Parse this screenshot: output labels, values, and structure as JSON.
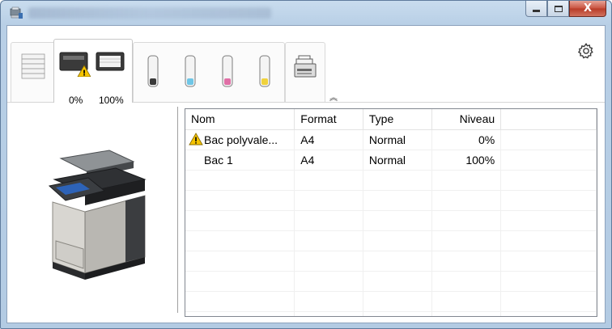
{
  "window": {
    "title": "",
    "controls": {
      "minimize": "–",
      "maximize": "□",
      "close": "X"
    }
  },
  "tabs": [
    {
      "name": "pages",
      "icon": "pages-stack-icon"
    },
    {
      "name": "trays",
      "icon": "paper-tray-icon",
      "values": [
        "0%",
        "100%"
      ],
      "active": true
    },
    {
      "name": "toner",
      "icon": "toner-cartridge-icon",
      "cartridges": [
        "black",
        "cyan",
        "magenta",
        "yellow"
      ]
    },
    {
      "name": "device",
      "icon": "scanner-device-icon"
    }
  ],
  "tray_levels": {
    "multipurpose": 0,
    "tray1": 1.0
  },
  "table": {
    "columns": [
      "Nom",
      "Format",
      "Type",
      "Niveau"
    ],
    "rows": [
      {
        "name": "Bac polyvale...",
        "format": "A4",
        "type": "Normal",
        "level": "0%",
        "warning": true
      },
      {
        "name": "Bac 1",
        "format": "A4",
        "type": "Normal",
        "level": "100%",
        "warning": false
      }
    ]
  },
  "colors": {
    "cyan": "#6fc6e6",
    "magenta": "#e06fa6",
    "yellow": "#f0d23c",
    "warning": "#f5c400"
  }
}
